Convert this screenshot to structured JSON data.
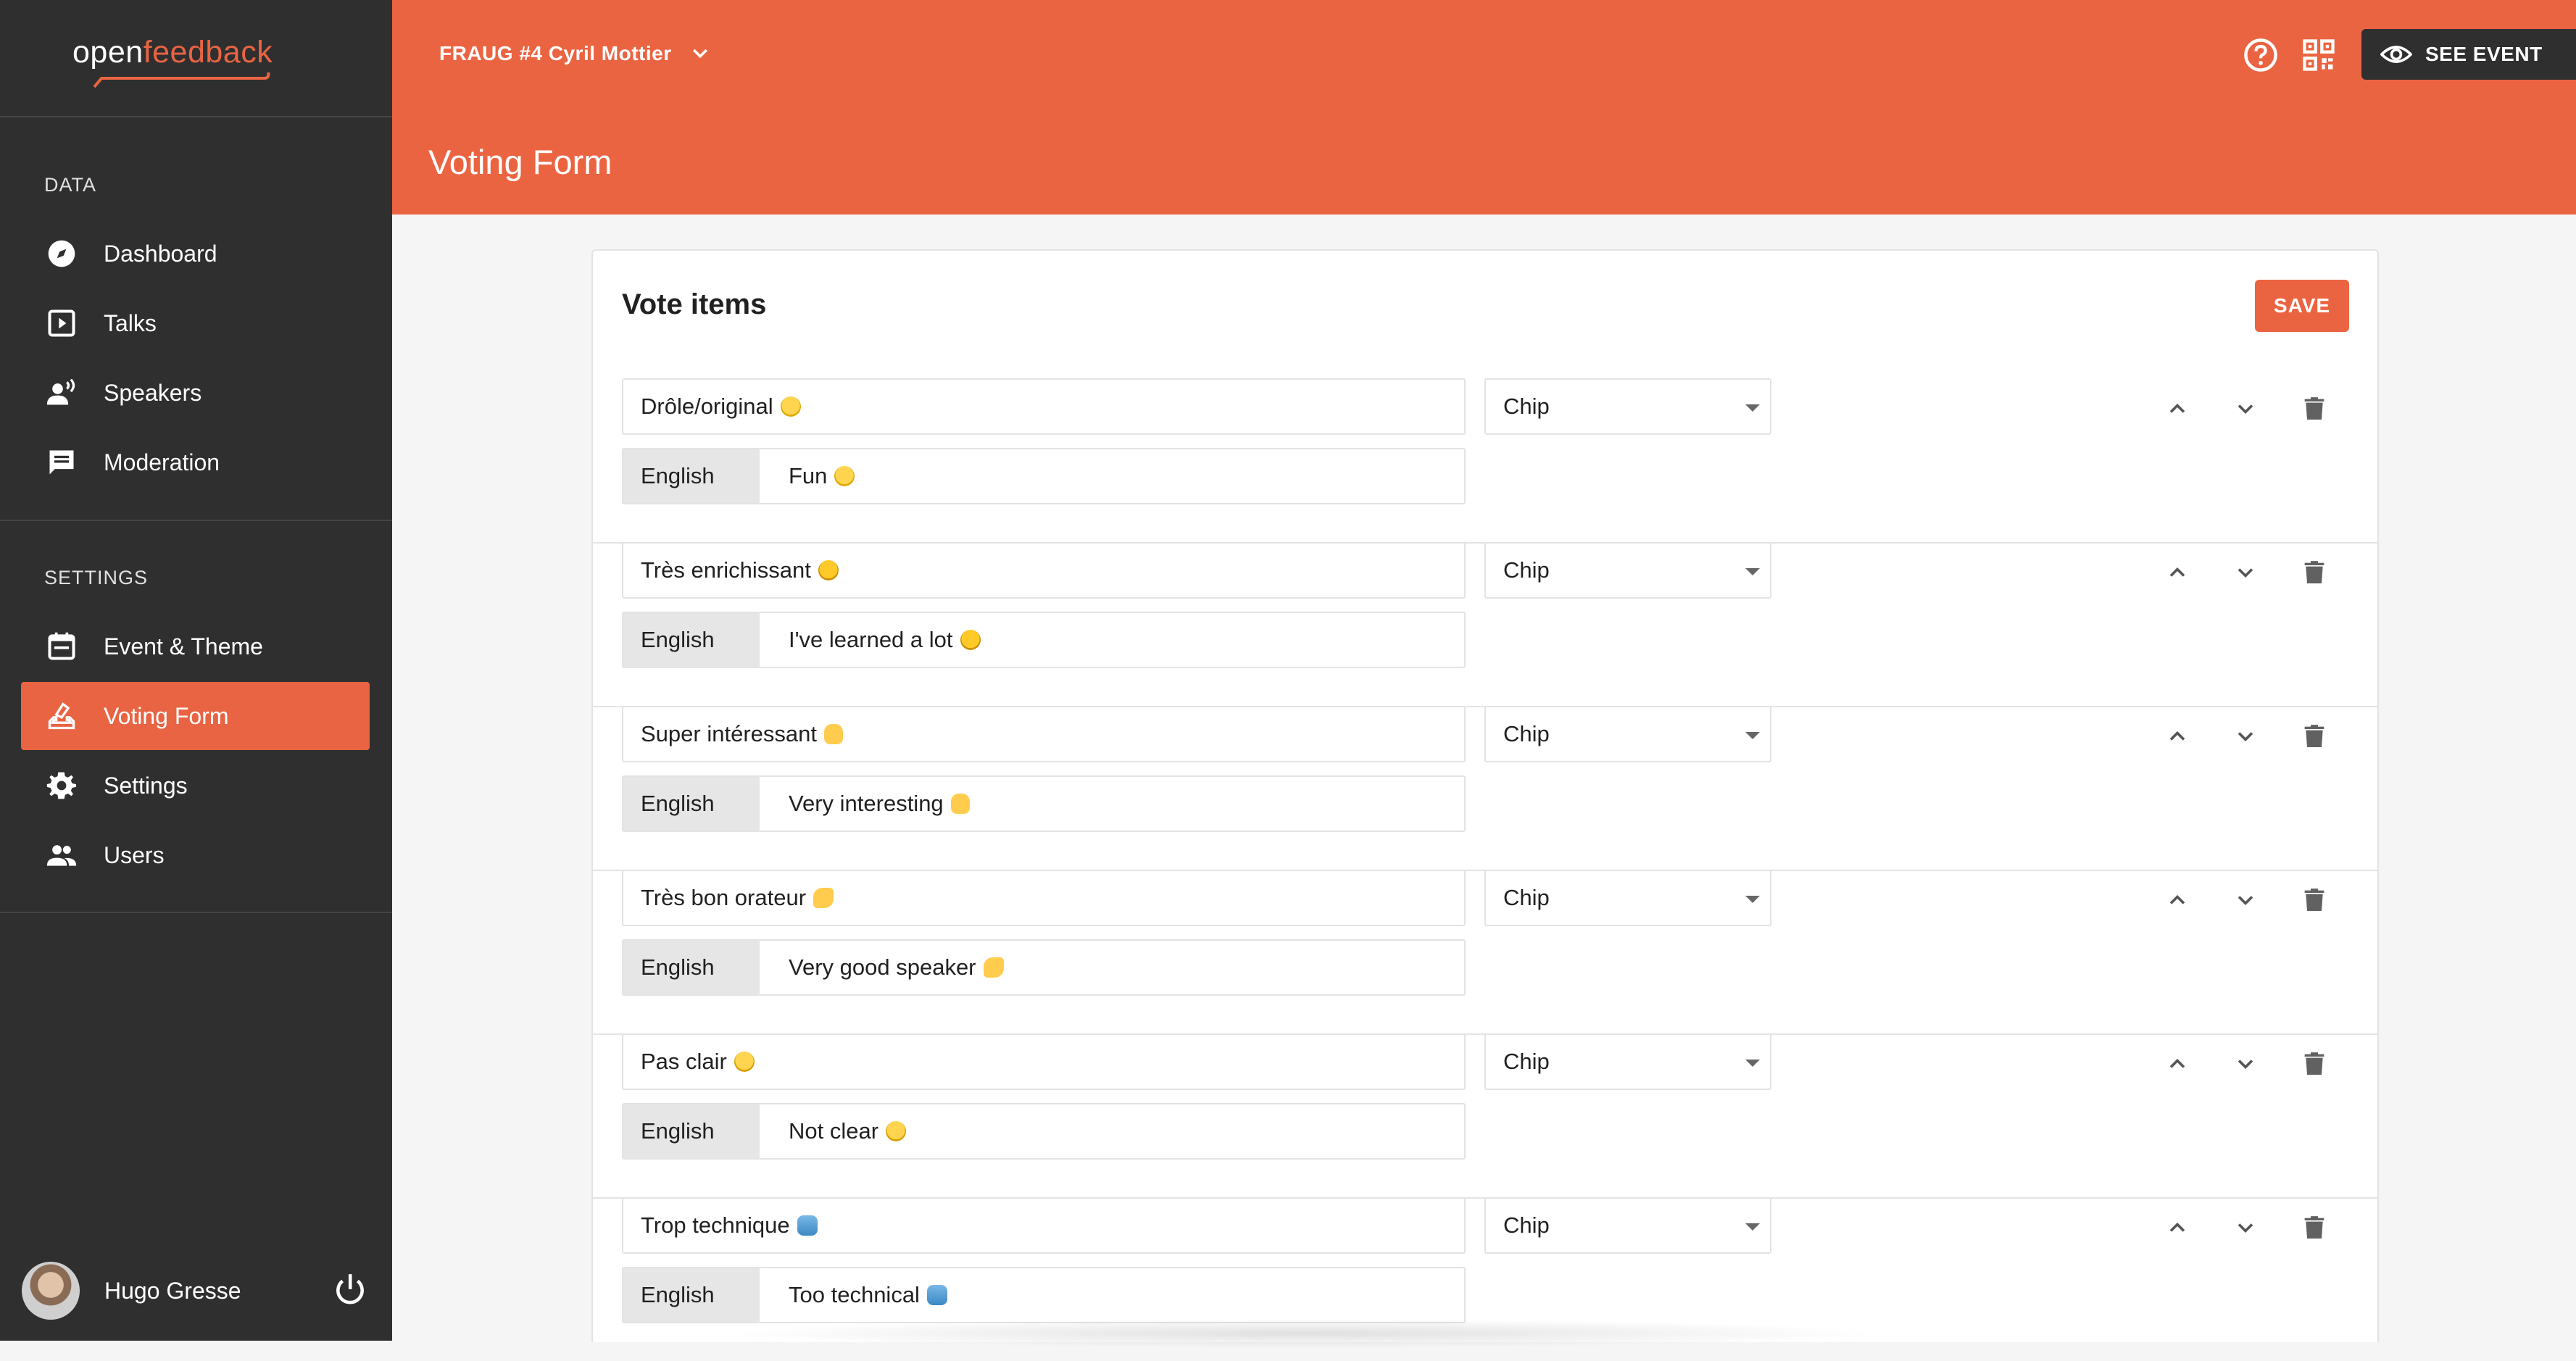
{
  "app": {
    "logo_part1": "open",
    "logo_part2": "feedback"
  },
  "sidebar": {
    "section_data": "DATA",
    "section_settings": "SETTINGS",
    "items": [
      {
        "label": "Dashboard",
        "icon": "compass-icon"
      },
      {
        "label": "Talks",
        "icon": "play-box-icon"
      },
      {
        "label": "Speakers",
        "icon": "speaker-person-icon"
      },
      {
        "label": "Moderation",
        "icon": "comment-icon"
      },
      {
        "label": "Event & Theme",
        "icon": "calendar-icon"
      },
      {
        "label": "Voting Form",
        "icon": "ballot-icon",
        "active": true
      },
      {
        "label": "Settings",
        "icon": "gear-icon"
      },
      {
        "label": "Users",
        "icon": "people-icon"
      }
    ],
    "user": {
      "name": "Hugo Gresse"
    }
  },
  "header": {
    "event_name": "FRAUG #4 Cyril Mottier",
    "page_title": "Voting Form",
    "see_event_label": "SEE EVENT"
  },
  "card": {
    "title": "Vote items",
    "save_label": "SAVE",
    "language_label": "English",
    "items": [
      {
        "text": "Drôle/original",
        "emoji": "smile",
        "translation": "Fun",
        "type": "Chip"
      },
      {
        "text": "Très enrichissant",
        "emoji": "nerd",
        "translation": "I've learned a lot",
        "type": "Chip"
      },
      {
        "text": "Super intéressant",
        "emoji": "thumb",
        "translation": "Very interesting",
        "type": "Chip"
      },
      {
        "text": "Très bon orateur",
        "emoji": "clap",
        "translation": "Very good speaker",
        "type": "Chip"
      },
      {
        "text": "Pas clair",
        "emoji": "think",
        "translation": "Not clear",
        "type": "Chip"
      },
      {
        "text": "Trop technique",
        "emoji": "robot",
        "translation": "Too technical",
        "type": "Chip"
      }
    ]
  },
  "colors": {
    "accent": "#eb6442",
    "sidebar": "#2f2f2f",
    "dark_button": "#2f2f2f"
  }
}
